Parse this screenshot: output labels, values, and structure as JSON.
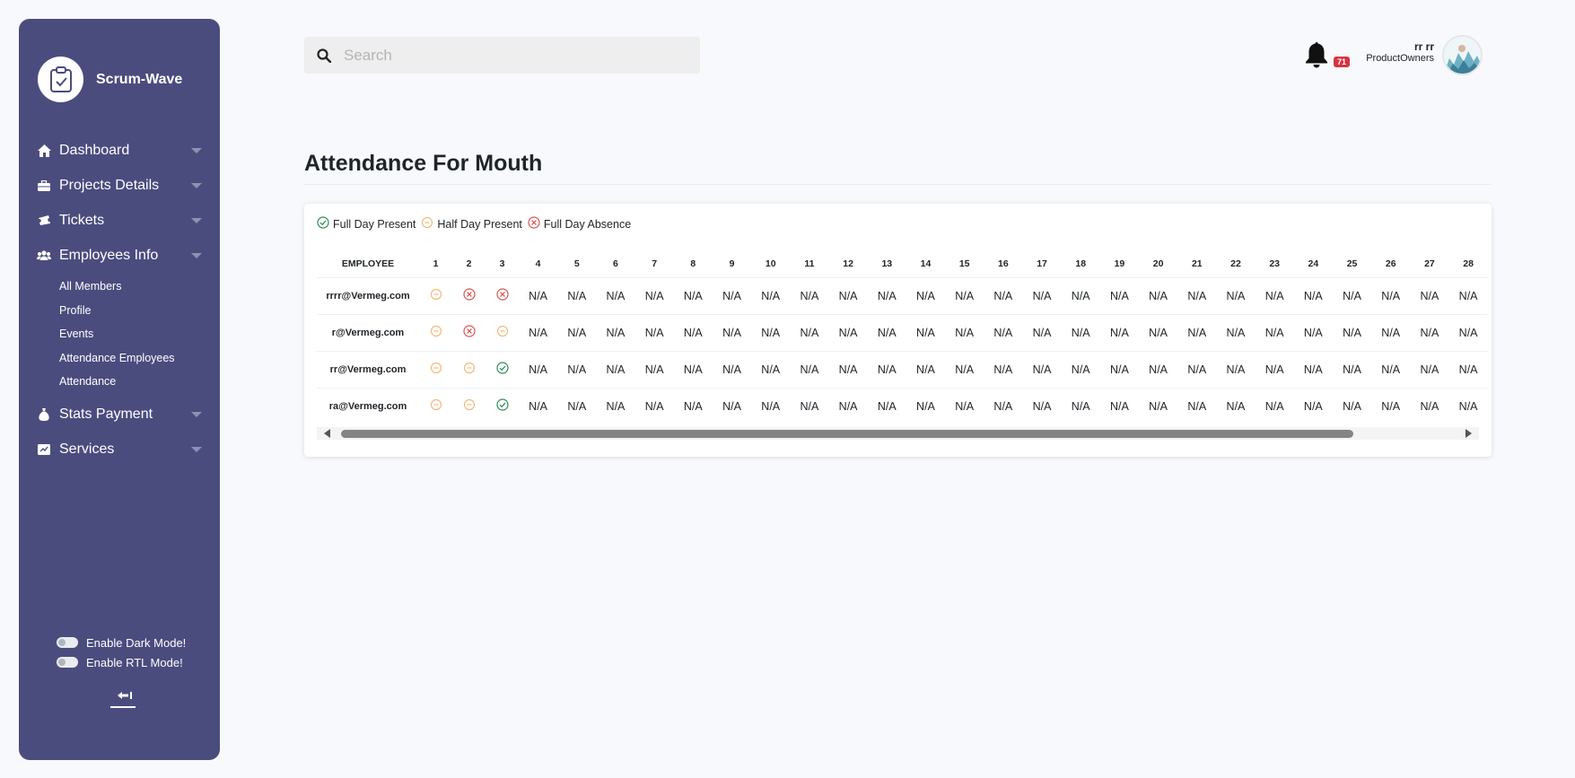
{
  "app": {
    "name": "Scrum-Wave"
  },
  "sidebar": {
    "items": [
      {
        "label": "Dashboard",
        "icon": "home-icon"
      },
      {
        "label": "Projects Details",
        "icon": "briefcase-icon"
      },
      {
        "label": "Tickets",
        "icon": "ticket-icon"
      },
      {
        "label": "Employees Info",
        "icon": "users-icon",
        "children": [
          "All Members",
          "Profile",
          "Events",
          "Attendance Employees",
          "Attendance"
        ]
      },
      {
        "label": "Stats Payment",
        "icon": "money-bag-icon"
      },
      {
        "label": "Services",
        "icon": "services-icon"
      }
    ],
    "dark_mode_label": "Enable Dark Mode!",
    "rtl_mode_label": "Enable RTL Mode!"
  },
  "search": {
    "placeholder": "Search"
  },
  "header": {
    "notification_count": "71",
    "user_name": "rr rr",
    "user_role": "ProductOwners"
  },
  "page": {
    "title": "Attendance For Mouth"
  },
  "legend": {
    "full_day_present": "Full Day Present",
    "half_day_present": "Half Day Present",
    "full_day_absence": "Full Day Absence"
  },
  "colors": {
    "present": "#2e8b57",
    "half": "#f5b97a",
    "absence": "#d9534f",
    "sidebar": "#4b4c7e"
  },
  "table": {
    "employee_header": "EMPLOYEE",
    "days": [
      "1",
      "2",
      "3",
      "4",
      "5",
      "6",
      "7",
      "8",
      "9",
      "10",
      "11",
      "12",
      "13",
      "14",
      "15",
      "16",
      "17",
      "18",
      "19",
      "20",
      "21",
      "22",
      "23",
      "24",
      "25",
      "26",
      "27",
      "28"
    ],
    "na_text": "N/A",
    "rows": [
      {
        "employee": "rrrr@Vermeg.com",
        "marks": [
          "half",
          "absence",
          "absence"
        ]
      },
      {
        "employee": "r@Vermeg.com",
        "marks": [
          "half",
          "absence",
          "half"
        ]
      },
      {
        "employee": "rr@Vermeg.com",
        "marks": [
          "half",
          "half",
          "present"
        ]
      },
      {
        "employee": "ra@Vermeg.com",
        "marks": [
          "half",
          "half",
          "present"
        ]
      }
    ]
  }
}
